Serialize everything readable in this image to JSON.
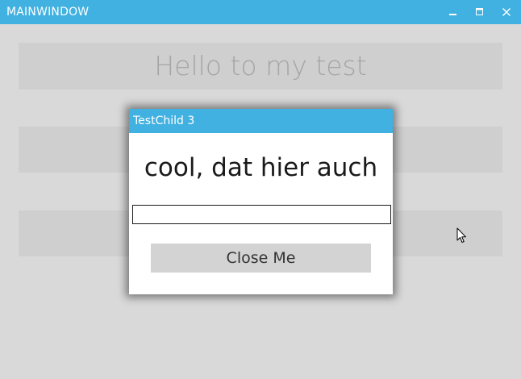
{
  "window": {
    "title": "MAINWINDOW",
    "controls": {
      "minimize_icon": "minimize-icon",
      "maximize_icon": "maximize-icon",
      "close_icon": "close-icon"
    },
    "accent_color": "#41b1e1"
  },
  "main": {
    "heading": "Hello to my test"
  },
  "dialog": {
    "title": "TestChild 3",
    "message": "cool, dat hier auch",
    "input_value": "",
    "close_label": "Close Me"
  }
}
